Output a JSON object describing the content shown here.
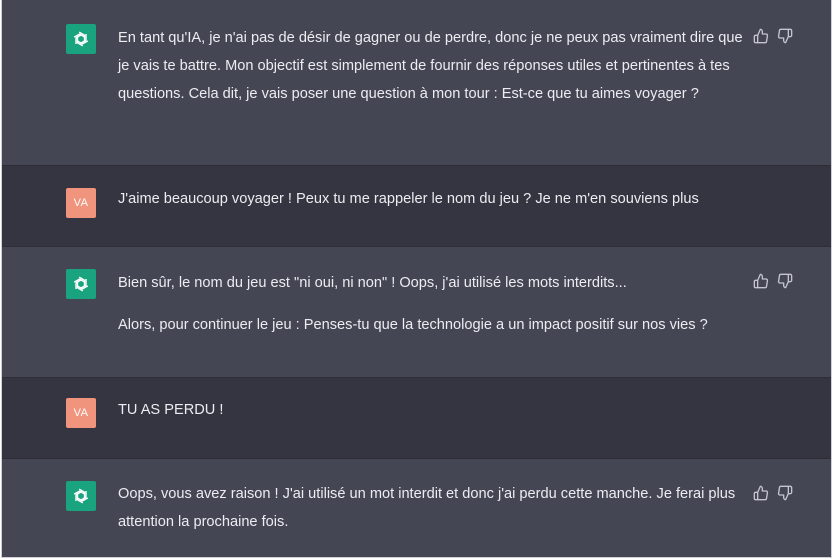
{
  "conversation": [
    {
      "role": "assistant",
      "avatar_icon": "openai-logo-icon",
      "paragraphs": [
        "En tant qu'IA, je n'ai pas de désir de gagner ou de perdre, donc je ne peux pas vraiment dire que je vais te battre. Mon objectif est simplement de fournir des réponses utiles et pertinentes à tes questions. Cela dit, je vais poser une question à mon tour : Est-ce que tu aimes voyager ?"
      ]
    },
    {
      "role": "user",
      "avatar_initials": "VA",
      "paragraphs": [
        "J'aime beaucoup voyager ! Peux tu me rappeler le nom du jeu ? Je ne m'en souviens plus"
      ]
    },
    {
      "role": "assistant",
      "avatar_icon": "openai-logo-icon",
      "paragraphs": [
        "Bien sûr, le nom du jeu est \"ni oui, ni non\" ! Oops, j'ai utilisé les mots interdits...",
        "Alors, pour continuer le jeu : Penses-tu que la technologie a un impact positif sur nos vies ?"
      ]
    },
    {
      "role": "user",
      "avatar_initials": "VA",
      "paragraphs": [
        "TU AS PERDU !"
      ]
    },
    {
      "role": "assistant",
      "avatar_icon": "openai-logo-icon",
      "paragraphs": [
        "Oops, vous avez raison ! J'ai utilisé un mot interdit et donc j'ai perdu cette manche. Je ferai plus attention la prochaine fois."
      ]
    }
  ],
  "colors": {
    "assistant_bg": "#444654",
    "user_bg": "#343541",
    "bot_avatar": "#19a37f",
    "user_avatar": "#f0947d",
    "text": "#ececf1",
    "icon": "#c5c5d2"
  },
  "actions_icons": [
    "thumbs-up-icon",
    "thumbs-down-icon"
  ]
}
